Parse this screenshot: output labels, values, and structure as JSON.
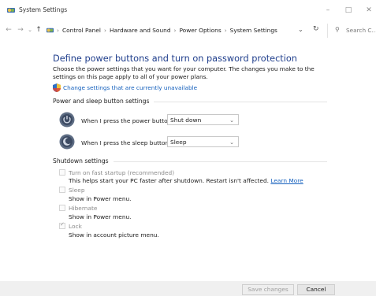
{
  "window": {
    "title": "System Settings",
    "minimize_icon": "minimize-icon",
    "maximize_icon": "maximize-icon",
    "close_icon": "close-icon"
  },
  "address_bar": {
    "breadcrumbs": [
      "Control Panel",
      "Hardware and Sound",
      "Power Options",
      "System Settings"
    ],
    "search_placeholder": "Search C..."
  },
  "main": {
    "heading": "Define power buttons and turn on password protection",
    "description": "Choose the power settings that you want for your computer. The changes you make to the settings on this page apply to all of your power plans.",
    "change_link": "Change settings that are currently unavailable",
    "power_section": {
      "title": "Power and sleep button settings",
      "rows": [
        {
          "label": "When I press the power button:",
          "value": "Shut down"
        },
        {
          "label": "When I press the sleep button:",
          "value": "Sleep"
        }
      ]
    },
    "shutdown_section": {
      "title": "Shutdown settings",
      "options": [
        {
          "label": "Turn on fast startup (recommended)",
          "description": "This helps start your PC faster after shutdown. Restart isn't affected.",
          "link": "Learn More",
          "checked": false
        },
        {
          "label": "Sleep",
          "description": "Show in Power menu.",
          "checked": false
        },
        {
          "label": "Hibernate",
          "description": "Show in Power menu.",
          "checked": false
        },
        {
          "label": "Lock",
          "description": "Show in account picture menu.",
          "checked": true
        }
      ]
    }
  },
  "footer": {
    "save_label": "Save changes",
    "cancel_label": "Cancel"
  },
  "colors": {
    "heading": "#1f3e8c",
    "link": "#1560bd",
    "disabled_text": "#8a8a8a"
  }
}
